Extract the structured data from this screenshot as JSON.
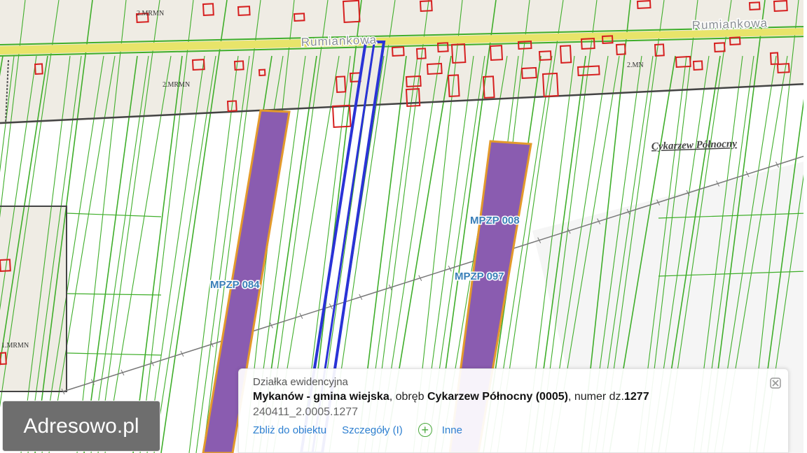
{
  "map": {
    "street_labels": [
      "Rumiankowa",
      "Rumiankowa"
    ],
    "zone_labels": [
      "2.MRMN",
      "2.MRMN",
      "2.MN",
      "1.MRMN"
    ],
    "locality_label": "Cykarzew Północny",
    "plan_labels": [
      "MPZP 084",
      "MPZP 008",
      "MPZP 097"
    ],
    "colors": {
      "plot_lines": "#3fae2a",
      "plan_fill": "#8a5cb0",
      "plan_border": "#e39a2c",
      "selected_parcel": "#2a33d6",
      "buildings": "#d62020",
      "road": "#e8e46a",
      "settlement_fill": "#efece4"
    }
  },
  "popup": {
    "title": "Działka ewidencyjna",
    "municipality": "Mykanów - gmina wiejska",
    "obreb_prefix": ", obręb ",
    "obreb": "Cykarzew Północny (0005)",
    "number_prefix": ", numer dz.",
    "number": "1277",
    "parcel_id": "240411_2.0005.1277",
    "actions": {
      "zoom": "Zbliż do obiektu",
      "details": "Szczegóły (I)",
      "other": "Inne"
    },
    "close_icon": "close-icon",
    "add_icon": "plus-circle-icon"
  },
  "brand": {
    "label": "Adresowo.pl"
  }
}
